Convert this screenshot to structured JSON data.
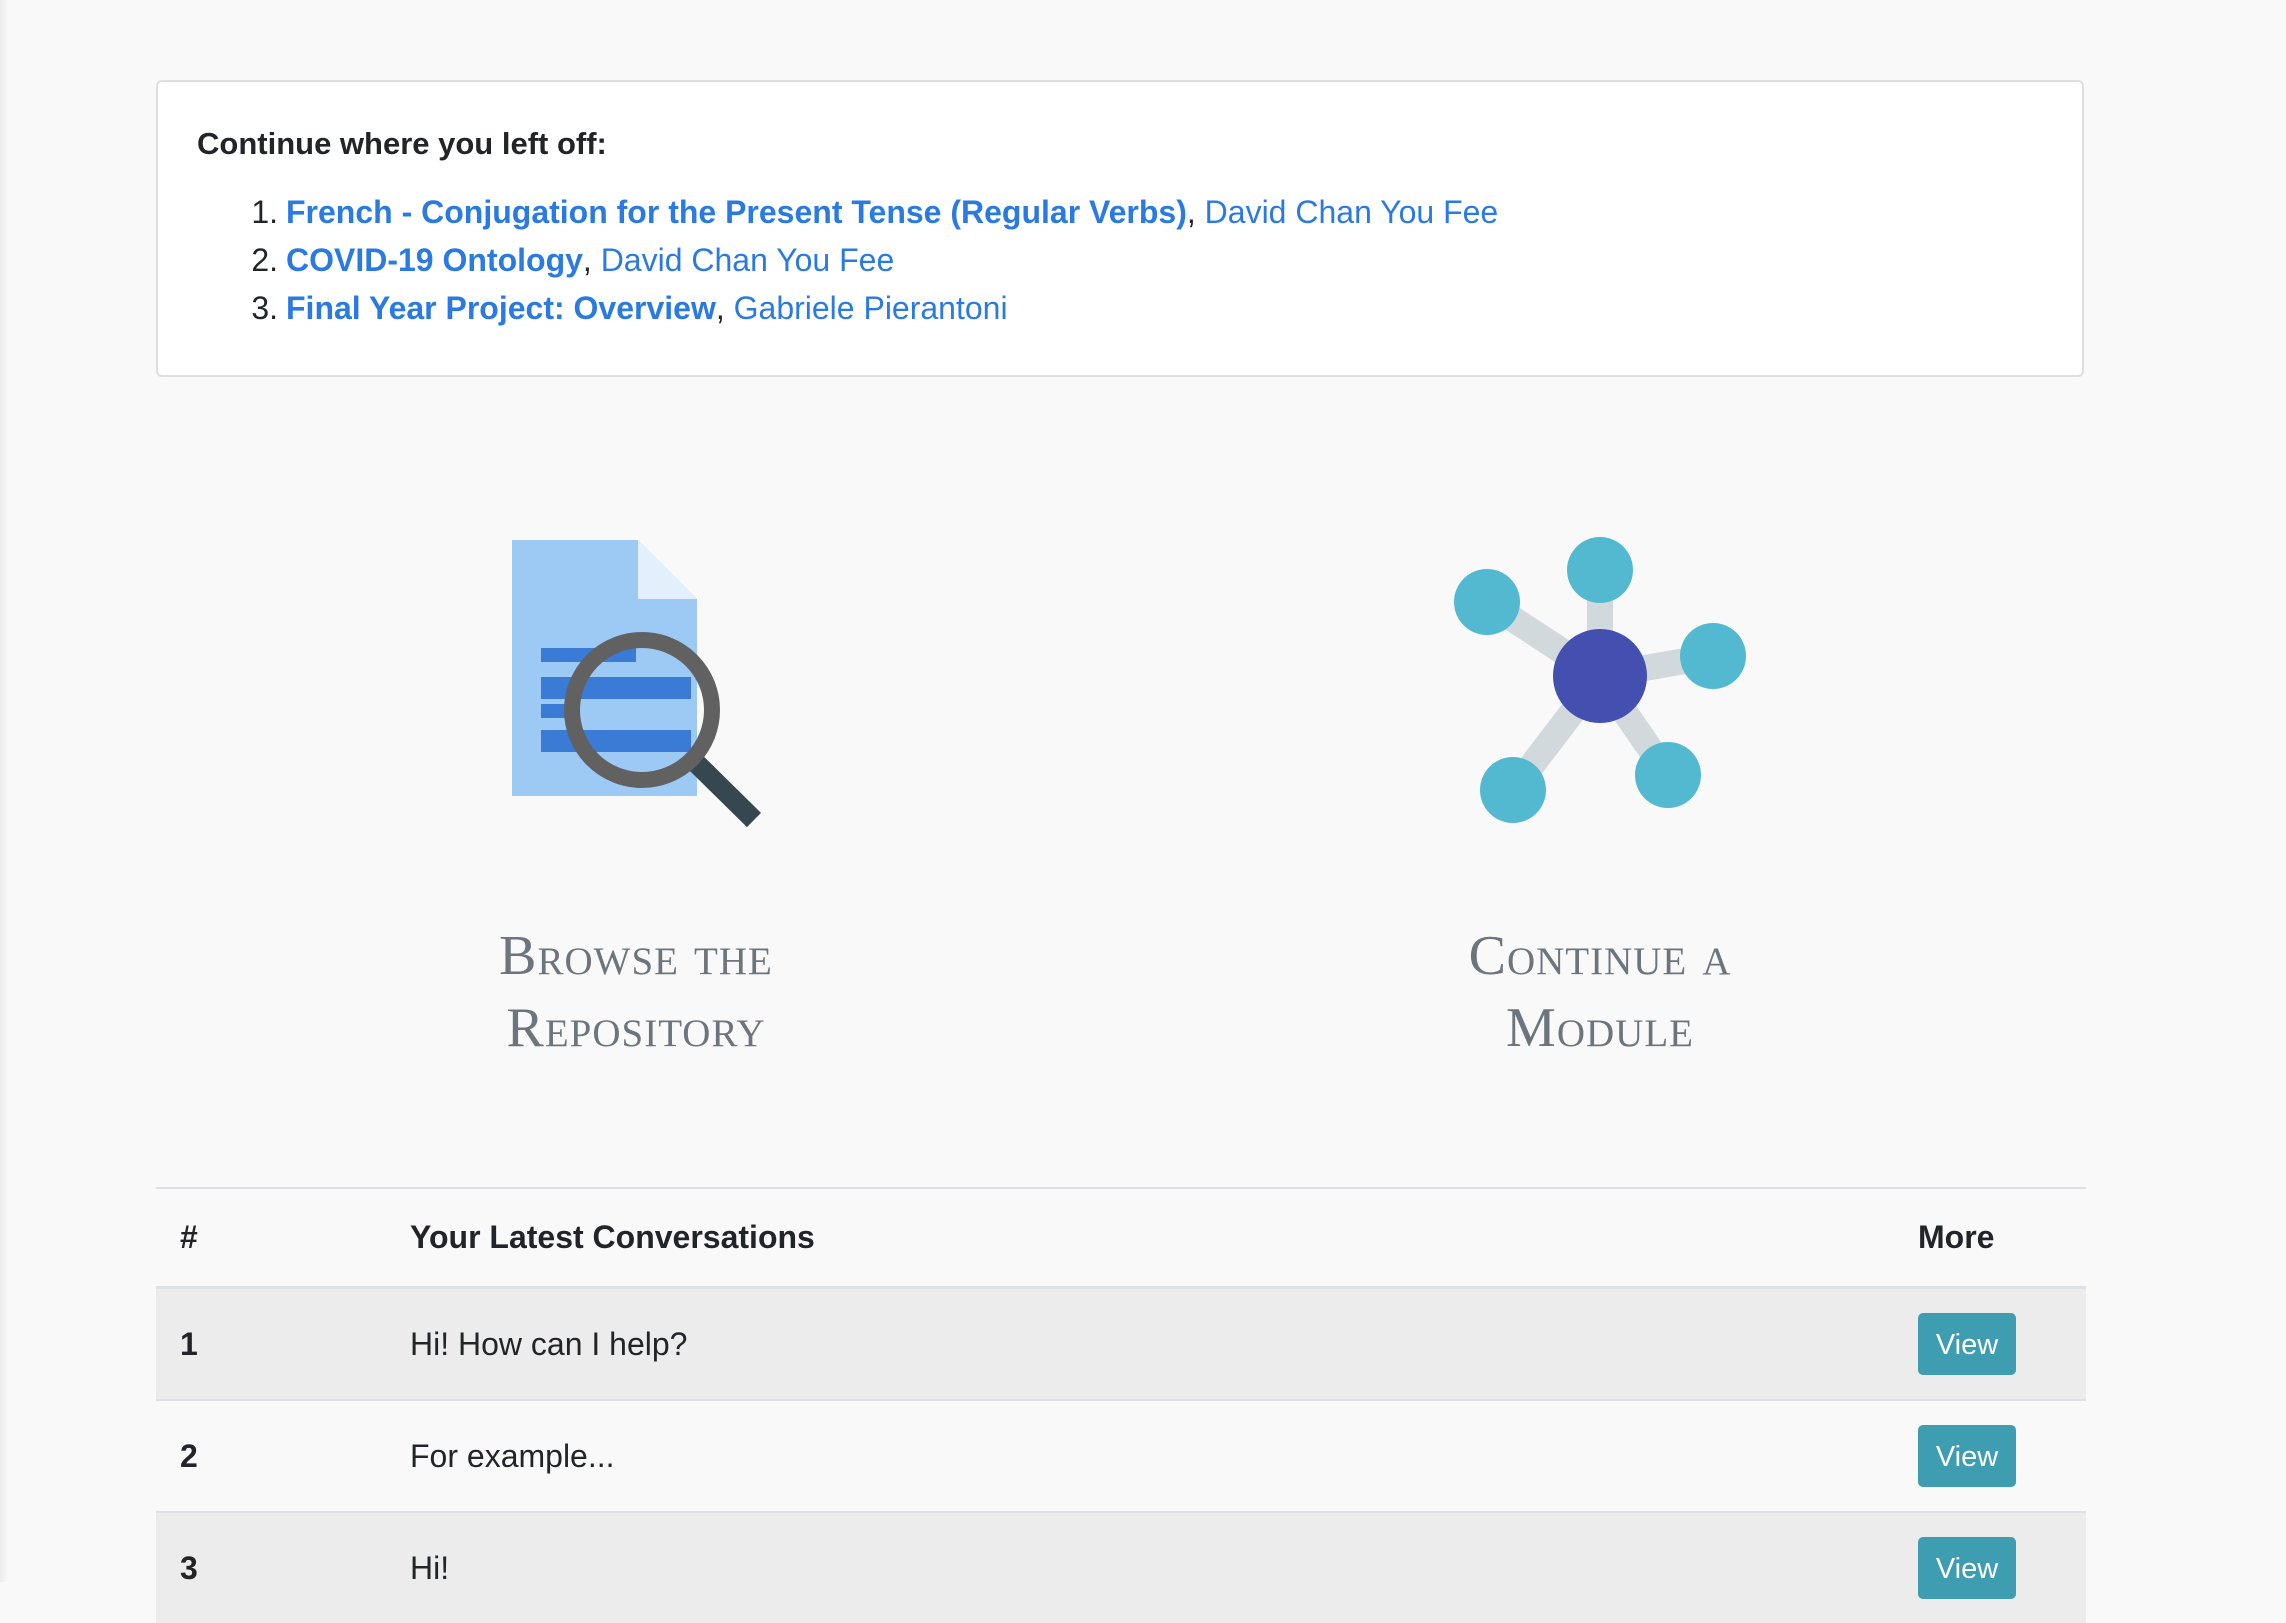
{
  "continue_card": {
    "heading": "Continue where you left off:",
    "items": [
      {
        "number": "1.",
        "title": "French - Conjugation for the Present Tense (Regular Verbs)",
        "author": "David Chan You Fee"
      },
      {
        "number": "2.",
        "title": "COVID-19 Ontology",
        "author": "David Chan You Fee"
      },
      {
        "number": "3.",
        "title": "Final Year Project: Overview",
        "author": "Gabriele Pierantoni"
      }
    ]
  },
  "tiles": {
    "browse": {
      "label": "Browse the\nRepository",
      "icon": "document-search-icon"
    },
    "module": {
      "label": "Continue a\nModule",
      "icon": "network-nodes-icon"
    }
  },
  "colors": {
    "link": "#2a7ae2",
    "button": "#3f9db2",
    "doc_light": "#9dc9f5",
    "doc_dark": "#3a7bd5",
    "node_cyan": "#52b9d1",
    "node_center": "#4350af"
  },
  "conversations": {
    "headers": {
      "num": "#",
      "title": "Your Latest Conversations",
      "more": "More"
    },
    "rows": [
      {
        "num": "1",
        "text": "Hi! How can I help?",
        "action": "View"
      },
      {
        "num": "2",
        "text": "For example...",
        "action": "View"
      },
      {
        "num": "3",
        "text": "Hi!",
        "action": "View"
      }
    ]
  }
}
